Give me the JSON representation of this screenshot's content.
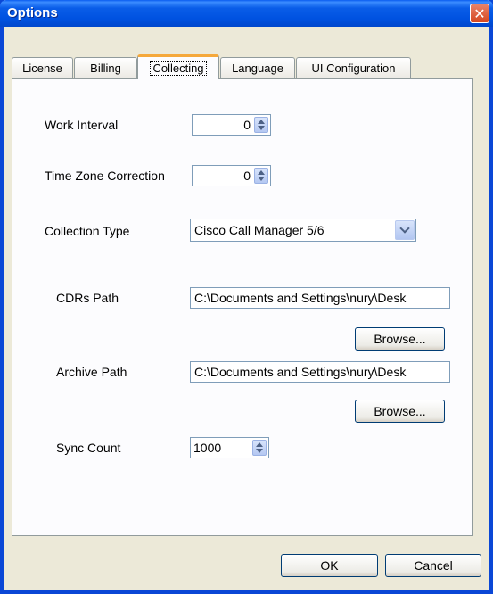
{
  "window": {
    "title": "Options"
  },
  "tabs": [
    {
      "label": "License"
    },
    {
      "label": "Billing"
    },
    {
      "label": "Collecting"
    },
    {
      "label": "Language"
    },
    {
      "label": "UI Configuration"
    }
  ],
  "form": {
    "work_interval": {
      "label": "Work Interval",
      "value": "0"
    },
    "time_zone": {
      "label": "Time Zone Correction",
      "value": "0"
    },
    "collection_type": {
      "label": "Collection Type",
      "value": "Cisco Call Manager 5/6"
    },
    "cdrs_path": {
      "label": "CDRs Path",
      "value": "C:\\Documents and Settings\\nury\\Desk",
      "browse": "Browse..."
    },
    "archive_path": {
      "label": "Archive Path",
      "value": "C:\\Documents and Settings\\nury\\Desk",
      "browse": "Browse..."
    },
    "sync_count": {
      "label": "Sync Count",
      "value": "1000"
    }
  },
  "footer": {
    "ok": "OK",
    "cancel": "Cancel"
  }
}
